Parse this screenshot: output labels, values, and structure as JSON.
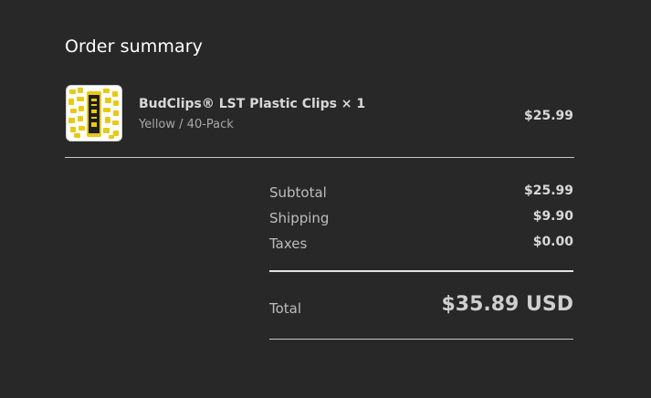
{
  "order_summary": {
    "title": "Order summary",
    "items": [
      {
        "name": "BudClips® LST Plastic Clips × 1",
        "variant": "Yellow / 40-Pack",
        "price": "$25.99",
        "thumbnail_icon": "product-thumbnail-image"
      }
    ],
    "totals": {
      "subtotal_label": "Subtotal",
      "subtotal_value": "$25.99",
      "shipping_label": "Shipping",
      "shipping_value": "$9.90",
      "taxes_label": "Taxes",
      "taxes_value": "$0.00",
      "total_label": "Total",
      "total_value": "$35.89 USD"
    }
  },
  "colors": {
    "background": "#282828",
    "text_primary": "#ffffff",
    "text_secondary": "#a8a8a8",
    "accent_yellow": "#f0d21a"
  }
}
